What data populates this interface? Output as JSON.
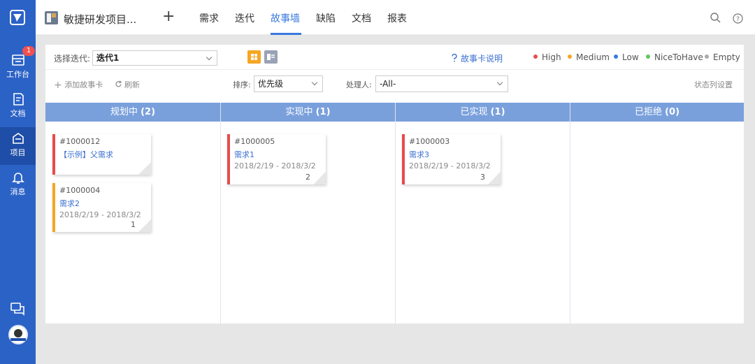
{
  "sidebar": {
    "items": [
      {
        "label": "工作台",
        "badge": "1",
        "icon": "workbench-icon"
      },
      {
        "label": "文档",
        "icon": "document-icon"
      },
      {
        "label": "项目",
        "icon": "project-icon",
        "active": true
      },
      {
        "label": "消息",
        "icon": "bell-icon"
      }
    ],
    "bottom": {
      "chat_icon": "chat-icon",
      "avatar": "avatar"
    }
  },
  "header": {
    "project_name": "敏捷研发项目...",
    "add_label": "+",
    "tabs": [
      {
        "label": "需求"
      },
      {
        "label": "迭代"
      },
      {
        "label": "故事墙",
        "active": true
      },
      {
        "label": "缺陷"
      },
      {
        "label": "文档"
      },
      {
        "label": "报表"
      }
    ]
  },
  "toolbar": {
    "iteration_label": "选择迭代:",
    "iteration_value": "迭代1",
    "story_help": "故事卡说明",
    "legend": [
      {
        "label": "High",
        "color": "#e94b4b"
      },
      {
        "label": "Medium",
        "color": "#f5a623"
      },
      {
        "label": "Low",
        "color": "#3a78e0"
      },
      {
        "label": "NiceToHave",
        "color": "#5bc85b"
      },
      {
        "label": "Empty",
        "color": "#aaaaaa"
      }
    ],
    "add_story": "添加故事卡",
    "refresh": "刷新",
    "sort_label": "排序:",
    "sort_value": "优先级",
    "assignee_label": "处理人:",
    "assignee_value": "-All-",
    "column_settings": "状态列设置"
  },
  "board": {
    "columns": [
      {
        "name": "规划中",
        "count": "(2)"
      },
      {
        "name": "实现中",
        "count": "(1)"
      },
      {
        "name": "已实现",
        "count": "(1)"
      },
      {
        "name": "已拒绝",
        "count": "(0)"
      }
    ],
    "cards": [
      {
        "id": "#1000012",
        "title": "【示例】父需求",
        "dates": "",
        "count": "",
        "priority": "High"
      },
      {
        "id": "#1000004",
        "title": "需求2",
        "dates": "2018/2/19 - 2018/3/2",
        "count": "1",
        "priority": "Medium"
      },
      {
        "id": "#1000005",
        "title": "需求1",
        "dates": "2018/2/19 - 2018/3/2",
        "count": "2",
        "priority": "High"
      },
      {
        "id": "#1000003",
        "title": "需求3",
        "dates": "2018/2/19 - 2018/3/2",
        "count": "3",
        "priority": "High"
      }
    ]
  }
}
